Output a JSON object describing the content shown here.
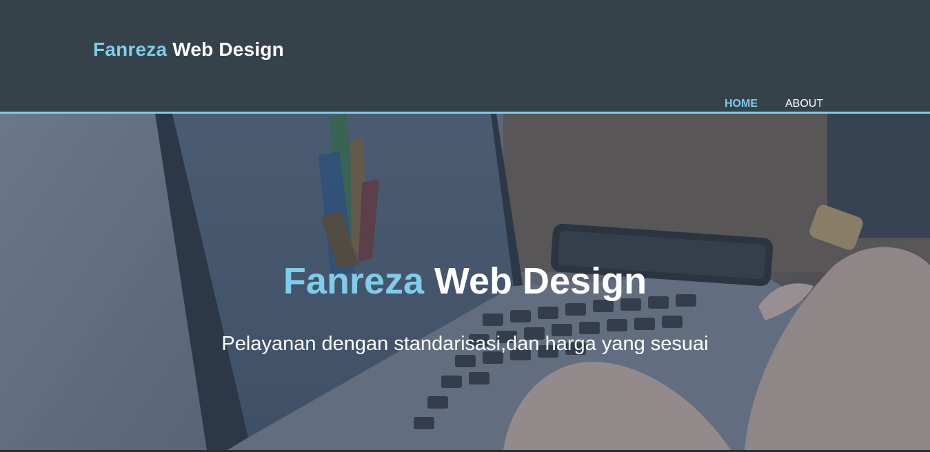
{
  "header": {
    "brand_accent": "Fanreza",
    "brand_rest": " Web Design"
  },
  "nav": {
    "items": [
      {
        "label": "HOME",
        "active": true
      },
      {
        "label": "ABOUT",
        "active": false
      }
    ]
  },
  "hero": {
    "title_accent": "Fanreza",
    "title_rest": " Web Design",
    "subtitle": "Pelayanan dengan standarisasi,dan harga yang sesuai",
    "background_description_icon": "laptop-photo"
  },
  "colors": {
    "header_bg": "#35424a",
    "accent": "#7fcde9",
    "text": "#ffffff"
  }
}
